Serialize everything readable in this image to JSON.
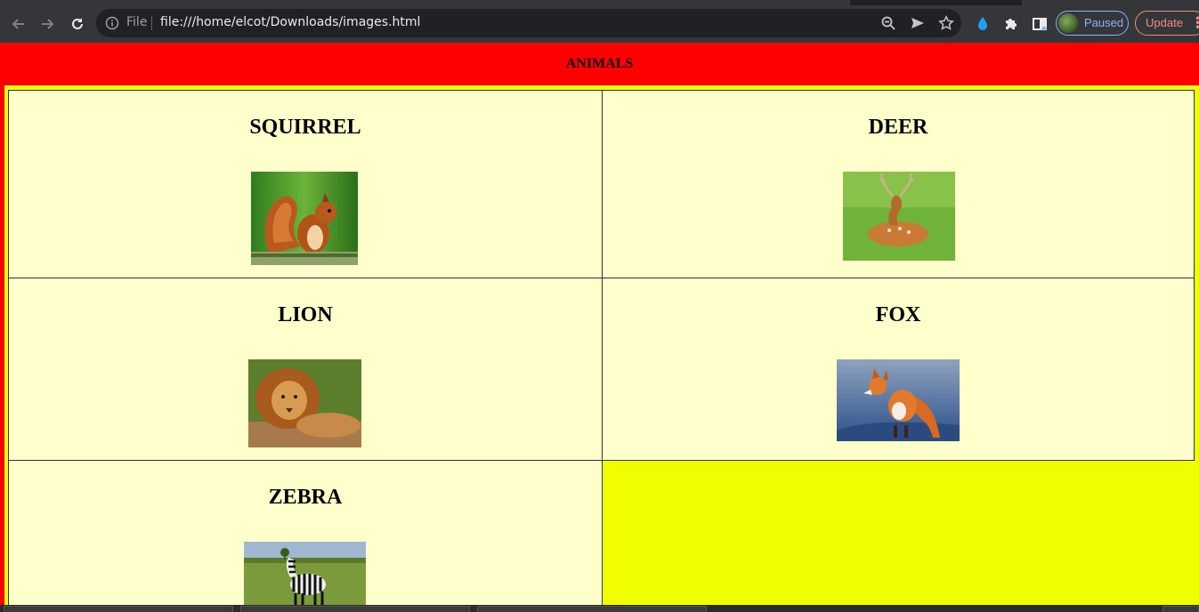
{
  "browser": {
    "omnibox": {
      "scheme_label": "File",
      "url": "file:///home/elcot/Downloads/images.html"
    },
    "profile_label": "Paused",
    "update_label": "Update",
    "icons": [
      "back-icon",
      "forward-icon",
      "reload-icon",
      "info-icon",
      "zoom-icon",
      "send-icon",
      "star-icon",
      "drop-extension-icon",
      "extensions-puzzle-icon",
      "reading-list-icon",
      "avatar",
      "menu-dots-icon"
    ],
    "colors": {
      "toolbar": "#35363a",
      "omnibox": "#202124",
      "profile_accent": "#8ab4f8",
      "update_accent": "#f28b82"
    }
  },
  "page": {
    "header_title": "ANIMALS",
    "colors": {
      "header_bg": "#ff0000",
      "table_bg": "#f0ff00",
      "cell_bg": "#ffffcc"
    },
    "animals": [
      {
        "name": "SQUIRREL",
        "image": "squirrel photo"
      },
      {
        "name": "DEER",
        "image": "deer photo"
      },
      {
        "name": "LION",
        "image": "lion photo"
      },
      {
        "name": "FOX",
        "image": "fox photo"
      },
      {
        "name": "ZEBRA",
        "image": "zebra photo"
      }
    ]
  }
}
